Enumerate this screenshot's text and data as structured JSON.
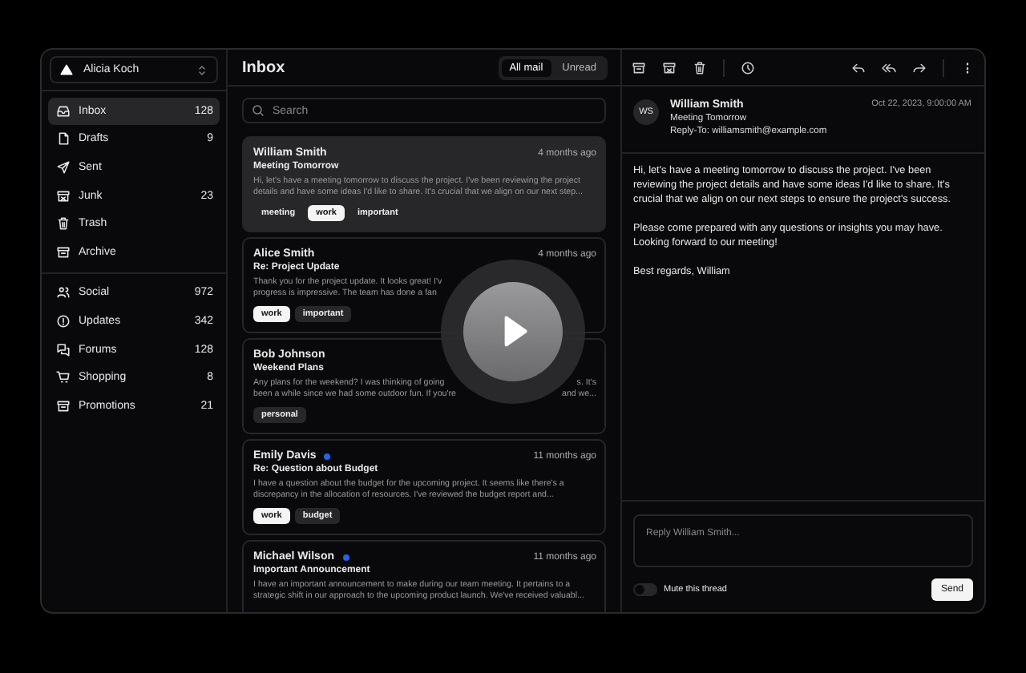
{
  "account": {
    "name": "Alicia Koch"
  },
  "folders": [
    {
      "label": "Inbox",
      "count": "128",
      "selected": true
    },
    {
      "label": "Drafts",
      "count": "9",
      "selected": false
    },
    {
      "label": "Sent",
      "selected": false
    },
    {
      "label": "Junk",
      "count": "23",
      "selected": false
    },
    {
      "label": "Trash",
      "selected": false
    },
    {
      "label": "Archive",
      "selected": false
    }
  ],
  "categories": [
    {
      "label": "Social",
      "count": "972",
      "selected": false
    },
    {
      "label": "Updates",
      "count": "342",
      "selected": false
    },
    {
      "label": "Forums",
      "count": "128",
      "selected": false
    },
    {
      "label": "Shopping",
      "count": "8",
      "selected": false
    },
    {
      "label": "Promotions",
      "count": "21",
      "selected": false
    }
  ],
  "list": {
    "title": "Inbox",
    "filters": [
      {
        "label": "All mail",
        "selected": true
      },
      {
        "label": "Unread",
        "selected": false
      }
    ],
    "search": {
      "placeholder": "Search"
    },
    "mails": [
      {
        "sender": "William Smith",
        "unread": false,
        "time": "4 months ago",
        "subject": "Meeting Tomorrow",
        "selected": true,
        "preview": [
          {
            "text": "Hi, let's have a meeting tomorrow to discuss the project. I've been reviewing the project"
          },
          {
            "text": "details and have some ideas I'd like to share. It's crucial that we align on our next step..."
          }
        ],
        "tags": [
          {
            "label": "meeting",
            "selected": false
          },
          {
            "label": "work",
            "selected": true
          },
          {
            "label": "important",
            "selected": false
          }
        ]
      },
      {
        "sender": "Alice Smith",
        "unread": false,
        "time": "4 months ago",
        "subject": "Re: Project Update",
        "selected": false,
        "preview": [
          {
            "text": "Thank you for the project update. It looks great! I'v"
          },
          {
            "text": "progress is impressive. The team has done a fan"
          }
        ],
        "tags": [
          {
            "label": "work",
            "selected": true
          },
          {
            "label": "important",
            "selected": false
          }
        ]
      },
      {
        "sender": "Bob Johnson",
        "unread": false,
        "subject": "Weekend Plans",
        "selected": false,
        "preview": [
          {
            "text": "Any plans for the weekend? I was thinking of going",
            "tail": "s. It's"
          },
          {
            "text": "been a while since we had some outdoor fun. If you're",
            "tail": "and we..."
          }
        ],
        "tags": [
          {
            "label": "personal",
            "selected": false
          }
        ]
      },
      {
        "sender": "Emily Davis",
        "unread": true,
        "time": "11 months ago",
        "subject": "Re: Question about Budget",
        "selected": false,
        "preview": [
          {
            "text": "I have a question about the budget for the upcoming project. It seems like there's a"
          },
          {
            "text": "discrepancy in the allocation of resources. I've reviewed the budget report and..."
          }
        ],
        "tags": [
          {
            "label": "work",
            "selected": true
          },
          {
            "label": "budget",
            "selected": false
          }
        ]
      },
      {
        "sender": "Michael Wilson",
        "unread": true,
        "time": "11 months ago",
        "subject": "Important Announcement",
        "selected": false,
        "preview": [
          {
            "text": "I have an important announcement to make during our team meeting. It pertains to a"
          },
          {
            "text": "strategic shift in our approach to the upcoming product launch. We've received valuabl..."
          }
        ]
      }
    ]
  },
  "reader": {
    "avatar": "WS",
    "sender": "William Smith",
    "subject": "Meeting Tomorrow",
    "reply_to": "Reply-To: williamsmith@example.com",
    "date": "Oct 22, 2023, 9:00:00 AM",
    "body": [
      "Hi, let's have a meeting tomorrow to discuss the project. I've been reviewing the project details and have some ideas I'd like to share. It's crucial that we align on our next steps to ensure the project's success.",
      "Please come prepared with any questions or insights you may have. Looking forward to our meeting!",
      "Best regards, William"
    ],
    "reply": {
      "placeholder": "Reply William Smith..."
    },
    "mute": {
      "label": "Mute this thread",
      "on": false
    },
    "send": "Send"
  }
}
